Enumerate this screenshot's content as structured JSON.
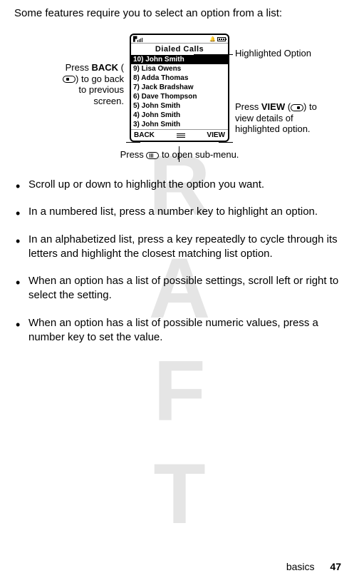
{
  "watermark": "DRAFT",
  "intro": "Some features require you to select an option from a list:",
  "phone": {
    "title": "Dialed Calls",
    "items": [
      "10) John Smith",
      "9) Lisa Owens",
      "8) Adda Thomas",
      "7) Jack Bradshaw",
      "6) Dave Thompson",
      "5) John Smith",
      "4) John Smith",
      "3) John Smith"
    ],
    "highlighted_index": 0,
    "softkey_left": "BACK",
    "softkey_right": "VIEW"
  },
  "callouts": {
    "left_prefix": "Press",
    "left_strong": "BACK",
    "left_suffix": " to go back to previous screen.",
    "right_top": "Highlighted Option",
    "right_bottom_prefix": "Press",
    "right_bottom_strong": "VIEW",
    "right_bottom_suffix": " to view details of highlighted option.",
    "bottom_prefix": "Press ",
    "bottom_suffix": " to open sub-menu."
  },
  "bullets": [
    "Scroll up or down to highlight the option you want.",
    "In a numbered list, press a number key to highlight an option.",
    "In an alphabetized list, press a key repeatedly to cycle through its letters and highlight the closest matching list option.",
    "When an option has a list of possible settings, scroll left or right to select the setting.",
    "When an option has a list of possible numeric values, press a number key to set the value."
  ],
  "footer": {
    "section": "basics",
    "page": "47"
  }
}
